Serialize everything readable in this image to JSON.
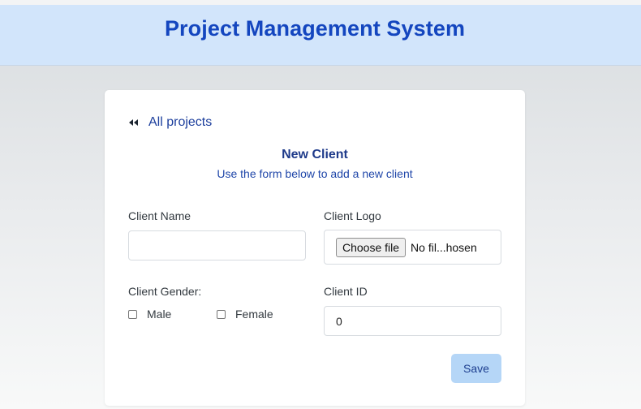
{
  "header": {
    "title": "Project Management System"
  },
  "back_link": {
    "label": "All projects",
    "icon": "double-chevron-left-icon"
  },
  "form": {
    "title": "New Client",
    "subtitle": "Use the form below to add a new client",
    "client_name": {
      "label": "Client Name",
      "value": ""
    },
    "client_logo": {
      "label": "Client Logo",
      "button_label": "Choose file",
      "status": "No fil...hosen"
    },
    "client_gender": {
      "label": "Client Gender:",
      "options": [
        {
          "label": "Male",
          "checked": false
        },
        {
          "label": "Female",
          "checked": false
        }
      ]
    },
    "client_id": {
      "label": "Client ID",
      "value": "0"
    },
    "save_label": "Save"
  },
  "colors": {
    "header_bg": "#d2e5fb",
    "title": "#1446bf",
    "link": "#1d3f9d",
    "save_bg": "#b5d6f7"
  }
}
